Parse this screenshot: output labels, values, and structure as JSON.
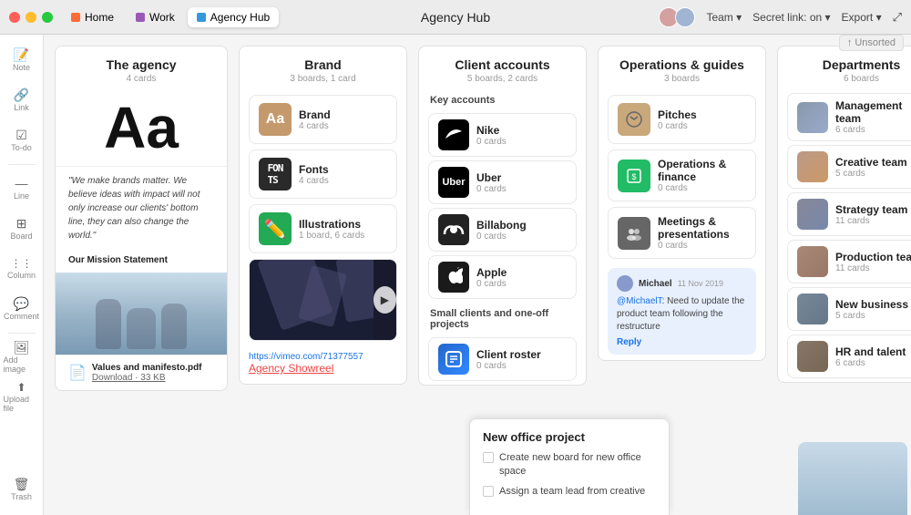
{
  "titlebar": {
    "title": "Agency Hub",
    "tabs": [
      {
        "label": "Home",
        "color": "#ff6b35",
        "active": false
      },
      {
        "label": "Work",
        "color": "#9b59b6",
        "active": false
      },
      {
        "label": "Agency Hub",
        "color": "#3498db",
        "active": true
      }
    ],
    "team_label": "Team ▾",
    "secret_link": "Secret link: on ▾",
    "export": "Export ▾"
  },
  "sidebar": {
    "items": [
      {
        "label": "Note",
        "icon": "📄"
      },
      {
        "label": "Link",
        "icon": "🔗"
      },
      {
        "label": "To-do",
        "icon": "☑"
      },
      {
        "label": "Line",
        "icon": "—"
      },
      {
        "label": "Board",
        "icon": "⊞"
      },
      {
        "label": "Column",
        "icon": "⋮⋮"
      },
      {
        "label": "Comment",
        "icon": "💬"
      },
      {
        "label": "Add image",
        "icon": "🖼"
      },
      {
        "label": "Upload file",
        "icon": "⬆"
      }
    ],
    "trash_label": "Trash",
    "trash_icon": "🗑"
  },
  "columns": {
    "agency": {
      "title": "The agency",
      "subtitle": "4 cards",
      "aa_text": "Aa",
      "quote": "\"We make brands matter. We believe ideas with impact will not only increase our clients' bottom line, they can also change the world.\"",
      "mission": "Our Mission Statement",
      "file_name": "Values and manifesto.pdf",
      "file_link": "Download · 33 KB"
    },
    "brand": {
      "title": "Brand",
      "subtitle": "3 boards, 1 card",
      "cards": [
        {
          "label": "Brand",
          "sub": "4 cards",
          "thumb_type": "brand"
        },
        {
          "label": "Fonts",
          "sub": "4 cards",
          "thumb_type": "font"
        },
        {
          "label": "Illustrations",
          "sub": "1 board, 6 cards",
          "thumb_type": "illus"
        }
      ],
      "video_url": "https://vimeo.com/71377557",
      "agency_showreel": "Agency Showreel"
    },
    "clients": {
      "title": "Client accounts",
      "subtitle": "5 boards, 2 cards",
      "key_accounts_label": "Key accounts",
      "small_label": "Small clients and one-off projects",
      "clients": [
        {
          "name": "Nike",
          "sub": "0 cards",
          "type": "nike"
        },
        {
          "name": "Uber",
          "sub": "0 cards",
          "type": "uber"
        },
        {
          "name": "Billabong",
          "sub": "0 cards",
          "type": "billabong"
        },
        {
          "name": "Apple",
          "sub": "0 cards",
          "type": "apple"
        }
      ],
      "roster": {
        "name": "Client roster",
        "sub": "0 cards"
      }
    },
    "operations": {
      "title": "Operations & guides",
      "subtitle": "3 boards",
      "cards": [
        {
          "label": "Pitches",
          "sub": "0 cards",
          "type": "pitches"
        },
        {
          "label": "Operations & finance",
          "sub": "0 cards",
          "type": "ops"
        },
        {
          "label": "Meetings & presentations",
          "sub": "0 cards",
          "type": "meetings"
        }
      ],
      "comment": {
        "author": "Michael",
        "date": "11 Nov 2019",
        "mention": "@MichaelT",
        "text": ": Need to update the product team following the restructure",
        "reply": "Reply"
      }
    },
    "departments": {
      "title": "Departments",
      "subtitle": "6 boards",
      "depts": [
        {
          "name": "Management team",
          "sub": "6 cards",
          "photo": "dp1"
        },
        {
          "name": "Creative team",
          "sub": "5 cards",
          "photo": "dp2"
        },
        {
          "name": "Strategy team",
          "sub": "11 cards",
          "photo": "dp3"
        },
        {
          "name": "Production team",
          "sub": "11 cards",
          "photo": "dp4"
        },
        {
          "name": "New business",
          "sub": "5 cards",
          "photo": "dp5"
        },
        {
          "name": "HR and talent",
          "sub": "6 cards",
          "photo": "dp6"
        }
      ]
    }
  },
  "unsorted_badge": "↑ Unsorted",
  "popup": {
    "title": "New office project",
    "items": [
      "Create new board for new office space",
      "Assign a team lead from creative"
    ]
  }
}
